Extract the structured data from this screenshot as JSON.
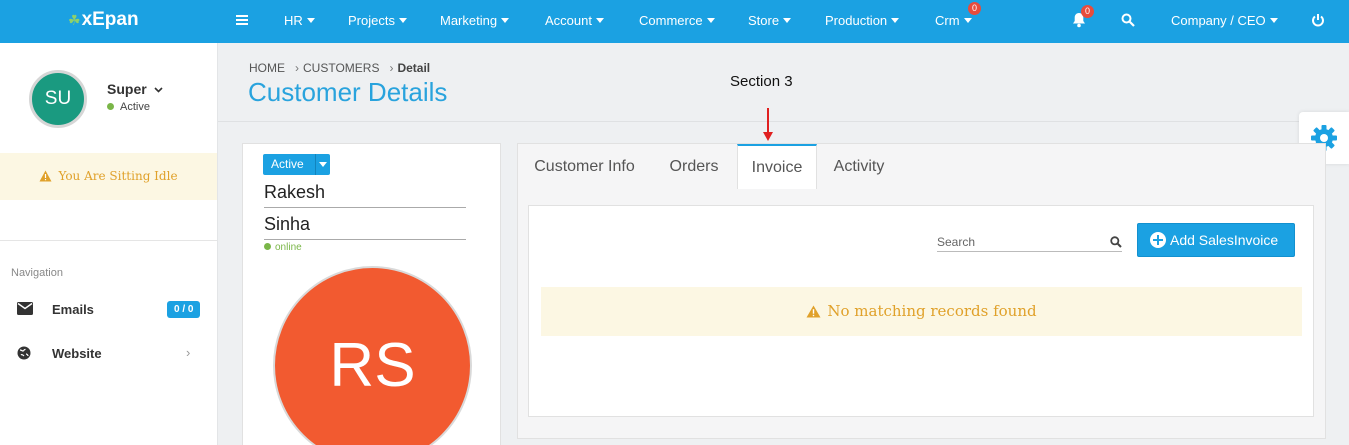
{
  "topbar": {
    "brand": "xEpan",
    "menu": [
      {
        "label": "HR"
      },
      {
        "label": "Projects"
      },
      {
        "label": "Marketing"
      },
      {
        "label": "Account"
      },
      {
        "label": "Commerce"
      },
      {
        "label": "Store"
      },
      {
        "label": "Production"
      },
      {
        "label": "Crm",
        "badge": "0"
      }
    ],
    "notifications_badge": "0",
    "company_menu": "Company / CEO",
    "accent": "#1ba1e2"
  },
  "sidebar": {
    "avatar_initials": "SU",
    "user_name": "Super",
    "user_status": "Active",
    "idle_message": "You Are Sitting Idle",
    "nav_title": "Navigation",
    "nav": [
      {
        "label": "Emails",
        "badge": "0 / 0",
        "icon": "envelope-icon"
      },
      {
        "label": "Website",
        "icon": "globe-icon"
      }
    ]
  },
  "breadcrumb": [
    "HOME",
    "CUSTOMERS",
    "Detail"
  ],
  "page_title": "Customer Details",
  "annotation": "Section 3",
  "customer": {
    "status": "Active",
    "first_name": "Rakesh",
    "last_name": "Sinha",
    "presence": "online",
    "initials": "RS",
    "avatar_color": "#f25a30"
  },
  "tabs": [
    {
      "label": "Customer Info"
    },
    {
      "label": "Orders"
    },
    {
      "label": "Invoice",
      "active": true
    },
    {
      "label": "Activity"
    }
  ],
  "invoice_panel": {
    "search_placeholder": "Search",
    "add_button": "Add SalesInvoice",
    "empty_message": "No matching records found"
  }
}
